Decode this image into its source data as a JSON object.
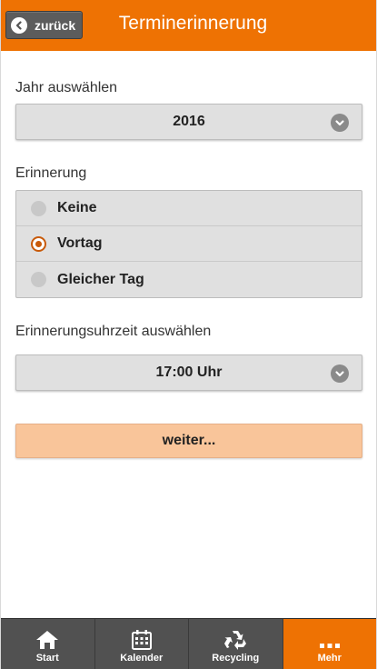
{
  "header": {
    "back_label": "zurück",
    "title": "Terminerinnerung"
  },
  "year": {
    "label": "Jahr auswählen",
    "value": "2016"
  },
  "reminder": {
    "label": "Erinnerung",
    "options": [
      {
        "label": "Keine",
        "selected": false
      },
      {
        "label": "Vortag",
        "selected": true
      },
      {
        "label": "Gleicher Tag",
        "selected": false
      }
    ]
  },
  "time": {
    "label": "Erinnerungsuhrzeit auswählen",
    "value": "17:00 Uhr"
  },
  "next_label": "weiter...",
  "footer": {
    "items": [
      {
        "label": "Start",
        "icon": "home-icon"
      },
      {
        "label": "Kalender",
        "icon": "calendar-icon"
      },
      {
        "label": "Recycling",
        "icon": "recycling-icon"
      },
      {
        "label": "Mehr",
        "icon": "more-icon"
      }
    ],
    "active": "Mehr"
  },
  "colors": {
    "accent": "#ee7203",
    "button_highlight": "#f9c59a",
    "footer_bg": "#515151"
  }
}
